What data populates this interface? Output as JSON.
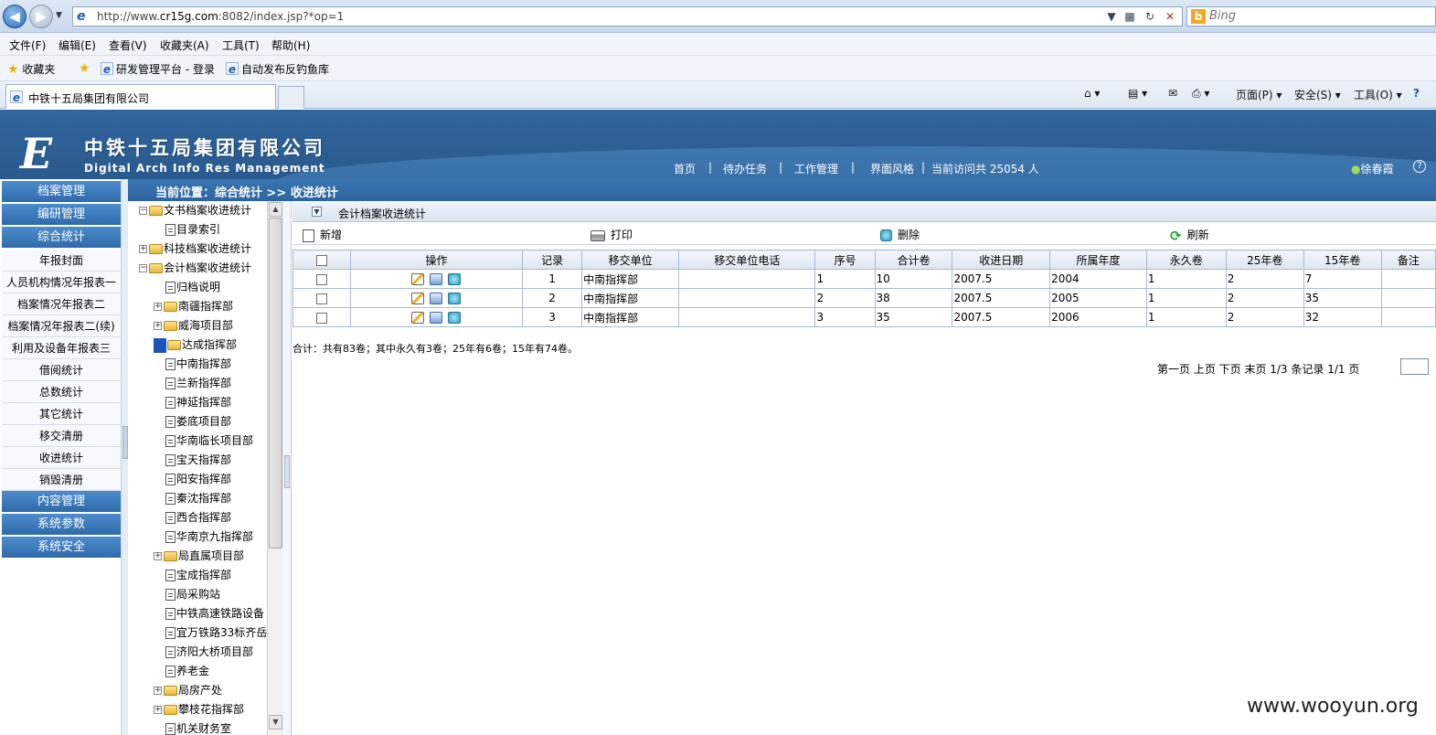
{
  "browser": {
    "url_prefix": "http://www.",
    "url_host": "cr15g.com",
    "url_rest": ":8082/index.jsp?*op=1",
    "search_placeholder": "Bing",
    "menu": [
      "文件(F)",
      "编辑(E)",
      "查看(V)",
      "收藏夹(A)",
      "工具(T)",
      "帮助(H)"
    ],
    "favorites_label": "收藏夹",
    "favorites": [
      "研发管理平台 - 登录",
      "自动发布反钓鱼库"
    ],
    "tab_title": "中铁十五局集团有限公司",
    "commands": [
      "页面(P)",
      "安全(S)",
      "工具(O)"
    ]
  },
  "header": {
    "logo_letter": "E",
    "company_cn": "中铁十五局集团有限公司",
    "company_en": "Digital Arch Info Res Management",
    "nav": [
      "首页",
      "|",
      "待办任务",
      "|",
      "工作管理",
      "|",
      "界面风格",
      "|",
      "当前访问共 25054 人"
    ],
    "user": "徐春霞"
  },
  "leftnav": {
    "items": [
      {
        "label": "档案管理",
        "kind": "primary"
      },
      {
        "label": "编研管理",
        "kind": "primary"
      },
      {
        "label": "综合统计",
        "kind": "primary"
      },
      {
        "label": "年报封面",
        "kind": "sub"
      },
      {
        "label": "人员机构情况年报表一",
        "kind": "sub"
      },
      {
        "label": "档案情况年报表二",
        "kind": "sub"
      },
      {
        "label": "档案情况年报表二(续)",
        "kind": "sub"
      },
      {
        "label": "利用及设备年报表三",
        "kind": "sub"
      },
      {
        "label": "借阅统计",
        "kind": "sub"
      },
      {
        "label": "总数统计",
        "kind": "sub"
      },
      {
        "label": "其它统计",
        "kind": "sub"
      },
      {
        "label": "移交清册",
        "kind": "sub"
      },
      {
        "label": "收进统计",
        "kind": "sub"
      },
      {
        "label": "销毁清册",
        "kind": "sub"
      },
      {
        "label": "内容管理",
        "kind": "primary"
      },
      {
        "label": "系统参数",
        "kind": "primary"
      },
      {
        "label": "系统安全",
        "kind": "primary"
      }
    ]
  },
  "breadcrumb": "当前位置：综合统计 >> 收进统计",
  "tree": {
    "items": [
      {
        "label": "文书档案收进统计",
        "indent": 0,
        "toggle": "−",
        "icon": "folder"
      },
      {
        "label": "目录索引",
        "indent": 1,
        "toggle": "",
        "icon": "doc"
      },
      {
        "label": "科技档案收进统计",
        "indent": 0,
        "toggle": "+",
        "icon": "folder"
      },
      {
        "label": "会计档案收进统计",
        "indent": 0,
        "toggle": "−",
        "icon": "folder"
      },
      {
        "label": "归档说明",
        "indent": 1,
        "toggle": "",
        "icon": "doc"
      },
      {
        "label": "南疆指挥部",
        "indent": 1,
        "toggle": "+",
        "icon": "folder"
      },
      {
        "label": "威海项目部",
        "indent": 1,
        "toggle": "+",
        "icon": "folder"
      },
      {
        "label": "达成指挥部",
        "indent": 1,
        "toggle": "sel",
        "icon": "folder"
      },
      {
        "label": "中南指挥部",
        "indent": 1,
        "toggle": "",
        "icon": "doc"
      },
      {
        "label": "兰新指挥部",
        "indent": 1,
        "toggle": "",
        "icon": "doc"
      },
      {
        "label": "神延指挥部",
        "indent": 1,
        "toggle": "",
        "icon": "doc"
      },
      {
        "label": "娄底项目部",
        "indent": 1,
        "toggle": "",
        "icon": "doc"
      },
      {
        "label": "华南临长项目部",
        "indent": 1,
        "toggle": "",
        "icon": "doc"
      },
      {
        "label": "宝天指挥部",
        "indent": 1,
        "toggle": "",
        "icon": "doc"
      },
      {
        "label": "阳安指挥部",
        "indent": 1,
        "toggle": "",
        "icon": "doc"
      },
      {
        "label": "秦沈指挥部",
        "indent": 1,
        "toggle": "",
        "icon": "doc"
      },
      {
        "label": "西合指挥部",
        "indent": 1,
        "toggle": "",
        "icon": "doc"
      },
      {
        "label": "华南京九指挥部",
        "indent": 1,
        "toggle": "",
        "icon": "doc"
      },
      {
        "label": "局直属项目部",
        "indent": 1,
        "toggle": "+",
        "icon": "folder"
      },
      {
        "label": "宝成指挥部",
        "indent": 1,
        "toggle": "",
        "icon": "doc"
      },
      {
        "label": "局采购站",
        "indent": 1,
        "toggle": "",
        "icon": "doc"
      },
      {
        "label": "中铁高速铁路设备",
        "indent": 1,
        "toggle": "",
        "icon": "doc"
      },
      {
        "label": "宜万铁路33标齐岳",
        "indent": 1,
        "toggle": "",
        "icon": "doc"
      },
      {
        "label": "济阳大桥项目部",
        "indent": 1,
        "toggle": "",
        "icon": "doc"
      },
      {
        "label": "养老金",
        "indent": 1,
        "toggle": "",
        "icon": "doc"
      },
      {
        "label": "局房产处",
        "indent": 1,
        "toggle": "+",
        "icon": "folder"
      },
      {
        "label": "攀枝花指挥部",
        "indent": 1,
        "toggle": "+",
        "icon": "folder"
      },
      {
        "label": "机关财务室",
        "indent": 1,
        "toggle": "",
        "icon": "doc"
      }
    ]
  },
  "panel": {
    "title": "会计档案收进统计",
    "toolbar": {
      "new": "新增",
      "print": "打印",
      "delete": "删除",
      "refresh": "刷新"
    },
    "columns": [
      "",
      "操作",
      "记录",
      "移交单位",
      "移交单位电话",
      "序号",
      "合计卷",
      "收进日期",
      "所属年度",
      "永久卷",
      "25年卷",
      "15年卷",
      "备注"
    ],
    "rows": [
      {
        "record": "1",
        "unit": "中南指挥部",
        "phone": "",
        "seq": "1",
        "total": "10",
        "date": "2007.5",
        "year": "2004",
        "perm": "1",
        "y25": "2",
        "y15": "7",
        "note": ""
      },
      {
        "record": "2",
        "unit": "中南指挥部",
        "phone": "",
        "seq": "2",
        "total": "38",
        "date": "2007.5",
        "year": "2005",
        "perm": "1",
        "y25": "2",
        "y15": "35",
        "note": ""
      },
      {
        "record": "3",
        "unit": "中南指挥部",
        "phone": "",
        "seq": "3",
        "total": "35",
        "date": "2007.5",
        "year": "2006",
        "perm": "1",
        "y25": "2",
        "y15": "32",
        "note": ""
      }
    ],
    "summary": "合计：共有83卷；其中永久有3卷；25年有6卷；15年有74卷。",
    "pager": "第一页 上页 下页 末页  1/3 条记录  1/1 页"
  },
  "watermark": "www.wooyun.org"
}
